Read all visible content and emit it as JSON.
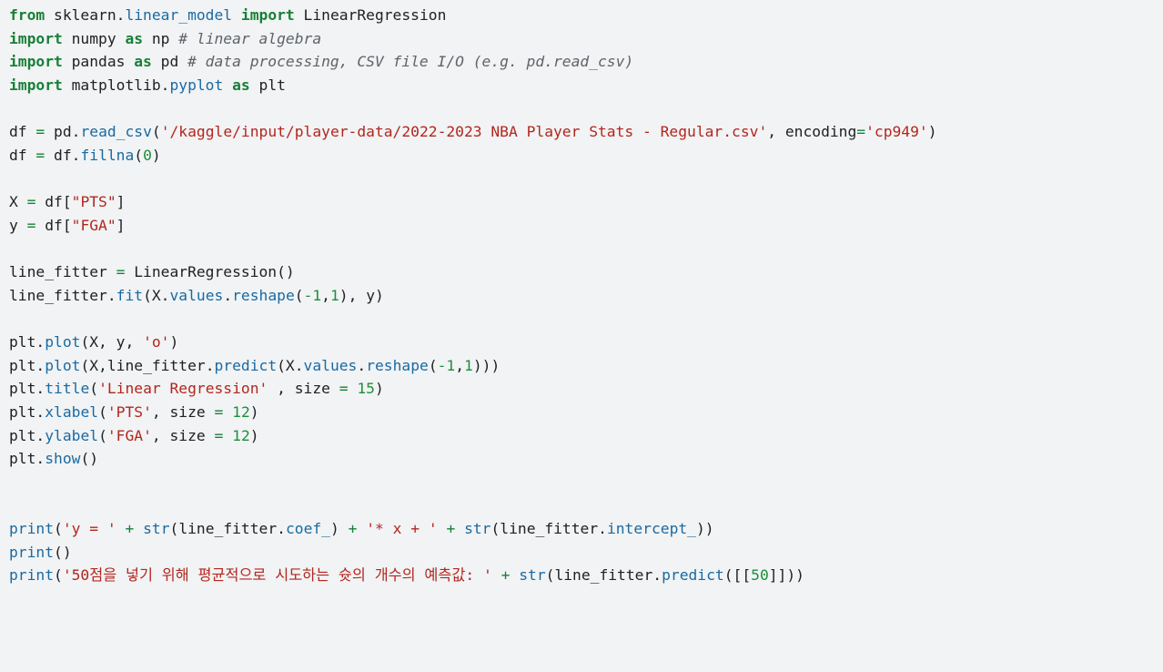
{
  "colors": {
    "background": "#f1f3f4",
    "text": "#202124",
    "keyword": "#188038",
    "function": "#1a6aa3",
    "string": "#b3261e",
    "number": "#1e8e3e",
    "comment": "#5f6368"
  },
  "code": {
    "lines": [
      {
        "tokens": [
          {
            "t": "from",
            "c": "kw"
          },
          {
            "t": " sklearn",
            "c": "id"
          },
          {
            "t": ".",
            "c": "id"
          },
          {
            "t": "linear_model",
            "c": "fn"
          },
          {
            "t": " ",
            "c": "id"
          },
          {
            "t": "import",
            "c": "kw"
          },
          {
            "t": " LinearRegression",
            "c": "id"
          }
        ]
      },
      {
        "tokens": [
          {
            "t": "import",
            "c": "kw"
          },
          {
            "t": " numpy ",
            "c": "id"
          },
          {
            "t": "as",
            "c": "kw"
          },
          {
            "t": " np ",
            "c": "id"
          },
          {
            "t": "# linear algebra",
            "c": "cm"
          }
        ]
      },
      {
        "tokens": [
          {
            "t": "import",
            "c": "kw"
          },
          {
            "t": " pandas ",
            "c": "id"
          },
          {
            "t": "as",
            "c": "kw"
          },
          {
            "t": " pd ",
            "c": "id"
          },
          {
            "t": "# data processing, CSV file I/O (e.g. pd.read_csv)",
            "c": "cm"
          }
        ]
      },
      {
        "tokens": [
          {
            "t": "import",
            "c": "kw"
          },
          {
            "t": " matplotlib",
            "c": "id"
          },
          {
            "t": ".",
            "c": "id"
          },
          {
            "t": "pyplot",
            "c": "fn"
          },
          {
            "t": " ",
            "c": "id"
          },
          {
            "t": "as",
            "c": "kw"
          },
          {
            "t": " plt",
            "c": "id"
          }
        ]
      },
      {
        "tokens": []
      },
      {
        "tokens": [
          {
            "t": "df ",
            "c": "id"
          },
          {
            "t": "=",
            "c": "op"
          },
          {
            "t": " pd",
            "c": "id"
          },
          {
            "t": ".",
            "c": "id"
          },
          {
            "t": "read_csv",
            "c": "fn"
          },
          {
            "t": "(",
            "c": "id"
          },
          {
            "t": "'/kaggle/input/player-data/2022-2023 NBA Player Stats - Regular.csv'",
            "c": "str"
          },
          {
            "t": ", encoding",
            "c": "id"
          },
          {
            "t": "=",
            "c": "op"
          },
          {
            "t": "'cp949'",
            "c": "str"
          },
          {
            "t": ")",
            "c": "id"
          }
        ]
      },
      {
        "tokens": [
          {
            "t": "df ",
            "c": "id"
          },
          {
            "t": "=",
            "c": "op"
          },
          {
            "t": " df",
            "c": "id"
          },
          {
            "t": ".",
            "c": "id"
          },
          {
            "t": "fillna",
            "c": "fn"
          },
          {
            "t": "(",
            "c": "id"
          },
          {
            "t": "0",
            "c": "num"
          },
          {
            "t": ")",
            "c": "id"
          }
        ]
      },
      {
        "tokens": []
      },
      {
        "tokens": [
          {
            "t": "X ",
            "c": "id"
          },
          {
            "t": "=",
            "c": "op"
          },
          {
            "t": " df[",
            "c": "id"
          },
          {
            "t": "\"PTS\"",
            "c": "str"
          },
          {
            "t": "]",
            "c": "id"
          }
        ]
      },
      {
        "tokens": [
          {
            "t": "y ",
            "c": "id"
          },
          {
            "t": "=",
            "c": "op"
          },
          {
            "t": " df[",
            "c": "id"
          },
          {
            "t": "\"FGA\"",
            "c": "str"
          },
          {
            "t": "]",
            "c": "id"
          }
        ]
      },
      {
        "tokens": []
      },
      {
        "tokens": [
          {
            "t": "line_fitter ",
            "c": "id"
          },
          {
            "t": "=",
            "c": "op"
          },
          {
            "t": " LinearRegression()",
            "c": "id"
          }
        ]
      },
      {
        "tokens": [
          {
            "t": "line_fitter",
            "c": "id"
          },
          {
            "t": ".",
            "c": "id"
          },
          {
            "t": "fit",
            "c": "fn"
          },
          {
            "t": "(X",
            "c": "id"
          },
          {
            "t": ".",
            "c": "id"
          },
          {
            "t": "values",
            "c": "fn"
          },
          {
            "t": ".",
            "c": "id"
          },
          {
            "t": "reshape",
            "c": "fn"
          },
          {
            "t": "(",
            "c": "id"
          },
          {
            "t": "-1",
            "c": "num"
          },
          {
            "t": ",",
            "c": "id"
          },
          {
            "t": "1",
            "c": "num"
          },
          {
            "t": "), y)",
            "c": "id"
          }
        ]
      },
      {
        "tokens": []
      },
      {
        "tokens": [
          {
            "t": "plt",
            "c": "id"
          },
          {
            "t": ".",
            "c": "id"
          },
          {
            "t": "plot",
            "c": "fn"
          },
          {
            "t": "(X, y, ",
            "c": "id"
          },
          {
            "t": "'o'",
            "c": "str"
          },
          {
            "t": ")",
            "c": "id"
          }
        ]
      },
      {
        "tokens": [
          {
            "t": "plt",
            "c": "id"
          },
          {
            "t": ".",
            "c": "id"
          },
          {
            "t": "plot",
            "c": "fn"
          },
          {
            "t": "(X,line_fitter",
            "c": "id"
          },
          {
            "t": ".",
            "c": "id"
          },
          {
            "t": "predict",
            "c": "fn"
          },
          {
            "t": "(X",
            "c": "id"
          },
          {
            "t": ".",
            "c": "id"
          },
          {
            "t": "values",
            "c": "fn"
          },
          {
            "t": ".",
            "c": "id"
          },
          {
            "t": "reshape",
            "c": "fn"
          },
          {
            "t": "(",
            "c": "id"
          },
          {
            "t": "-1",
            "c": "num"
          },
          {
            "t": ",",
            "c": "id"
          },
          {
            "t": "1",
            "c": "num"
          },
          {
            "t": ")))",
            "c": "id"
          }
        ]
      },
      {
        "tokens": [
          {
            "t": "plt",
            "c": "id"
          },
          {
            "t": ".",
            "c": "id"
          },
          {
            "t": "title",
            "c": "fn"
          },
          {
            "t": "(",
            "c": "id"
          },
          {
            "t": "'Linear Regression'",
            "c": "str"
          },
          {
            "t": " , size ",
            "c": "id"
          },
          {
            "t": "=",
            "c": "op"
          },
          {
            "t": " ",
            "c": "id"
          },
          {
            "t": "15",
            "c": "num"
          },
          {
            "t": ")",
            "c": "id"
          }
        ]
      },
      {
        "tokens": [
          {
            "t": "plt",
            "c": "id"
          },
          {
            "t": ".",
            "c": "id"
          },
          {
            "t": "xlabel",
            "c": "fn"
          },
          {
            "t": "(",
            "c": "id"
          },
          {
            "t": "'PTS'",
            "c": "str"
          },
          {
            "t": ", size ",
            "c": "id"
          },
          {
            "t": "=",
            "c": "op"
          },
          {
            "t": " ",
            "c": "id"
          },
          {
            "t": "12",
            "c": "num"
          },
          {
            "t": ")",
            "c": "id"
          }
        ]
      },
      {
        "tokens": [
          {
            "t": "plt",
            "c": "id"
          },
          {
            "t": ".",
            "c": "id"
          },
          {
            "t": "ylabel",
            "c": "fn"
          },
          {
            "t": "(",
            "c": "id"
          },
          {
            "t": "'FGA'",
            "c": "str"
          },
          {
            "t": ", size ",
            "c": "id"
          },
          {
            "t": "=",
            "c": "op"
          },
          {
            "t": " ",
            "c": "id"
          },
          {
            "t": "12",
            "c": "num"
          },
          {
            "t": ")",
            "c": "id"
          }
        ]
      },
      {
        "tokens": [
          {
            "t": "plt",
            "c": "id"
          },
          {
            "t": ".",
            "c": "id"
          },
          {
            "t": "show",
            "c": "fn"
          },
          {
            "t": "()",
            "c": "id"
          }
        ]
      },
      {
        "tokens": []
      },
      {
        "tokens": []
      },
      {
        "tokens": [
          {
            "t": "print",
            "c": "fn"
          },
          {
            "t": "(",
            "c": "id"
          },
          {
            "t": "'y = '",
            "c": "str"
          },
          {
            "t": " ",
            "c": "id"
          },
          {
            "t": "+",
            "c": "op"
          },
          {
            "t": " ",
            "c": "id"
          },
          {
            "t": "str",
            "c": "fn"
          },
          {
            "t": "(line_fitter",
            "c": "id"
          },
          {
            "t": ".",
            "c": "id"
          },
          {
            "t": "coef_",
            "c": "fn"
          },
          {
            "t": ") ",
            "c": "id"
          },
          {
            "t": "+",
            "c": "op"
          },
          {
            "t": " ",
            "c": "id"
          },
          {
            "t": "'* x + '",
            "c": "str"
          },
          {
            "t": " ",
            "c": "id"
          },
          {
            "t": "+",
            "c": "op"
          },
          {
            "t": " ",
            "c": "id"
          },
          {
            "t": "str",
            "c": "fn"
          },
          {
            "t": "(line_fitter",
            "c": "id"
          },
          {
            "t": ".",
            "c": "id"
          },
          {
            "t": "intercept_",
            "c": "fn"
          },
          {
            "t": "))",
            "c": "id"
          }
        ]
      },
      {
        "tokens": [
          {
            "t": "print",
            "c": "fn"
          },
          {
            "t": "()",
            "c": "id"
          }
        ]
      },
      {
        "tokens": [
          {
            "t": "print",
            "c": "fn"
          },
          {
            "t": "(",
            "c": "id"
          },
          {
            "t": "'50점을 넣기 위해 평균적으로 시도하는 슛의 개수의 예측값: '",
            "c": "str"
          },
          {
            "t": " ",
            "c": "id"
          },
          {
            "t": "+",
            "c": "op"
          },
          {
            "t": " ",
            "c": "id"
          },
          {
            "t": "str",
            "c": "fn"
          },
          {
            "t": "(line_fitter",
            "c": "id"
          },
          {
            "t": ".",
            "c": "id"
          },
          {
            "t": "predict",
            "c": "fn"
          },
          {
            "t": "([[",
            "c": "id"
          },
          {
            "t": "50",
            "c": "num"
          },
          {
            "t": "]]))",
            "c": "id"
          }
        ]
      }
    ]
  }
}
